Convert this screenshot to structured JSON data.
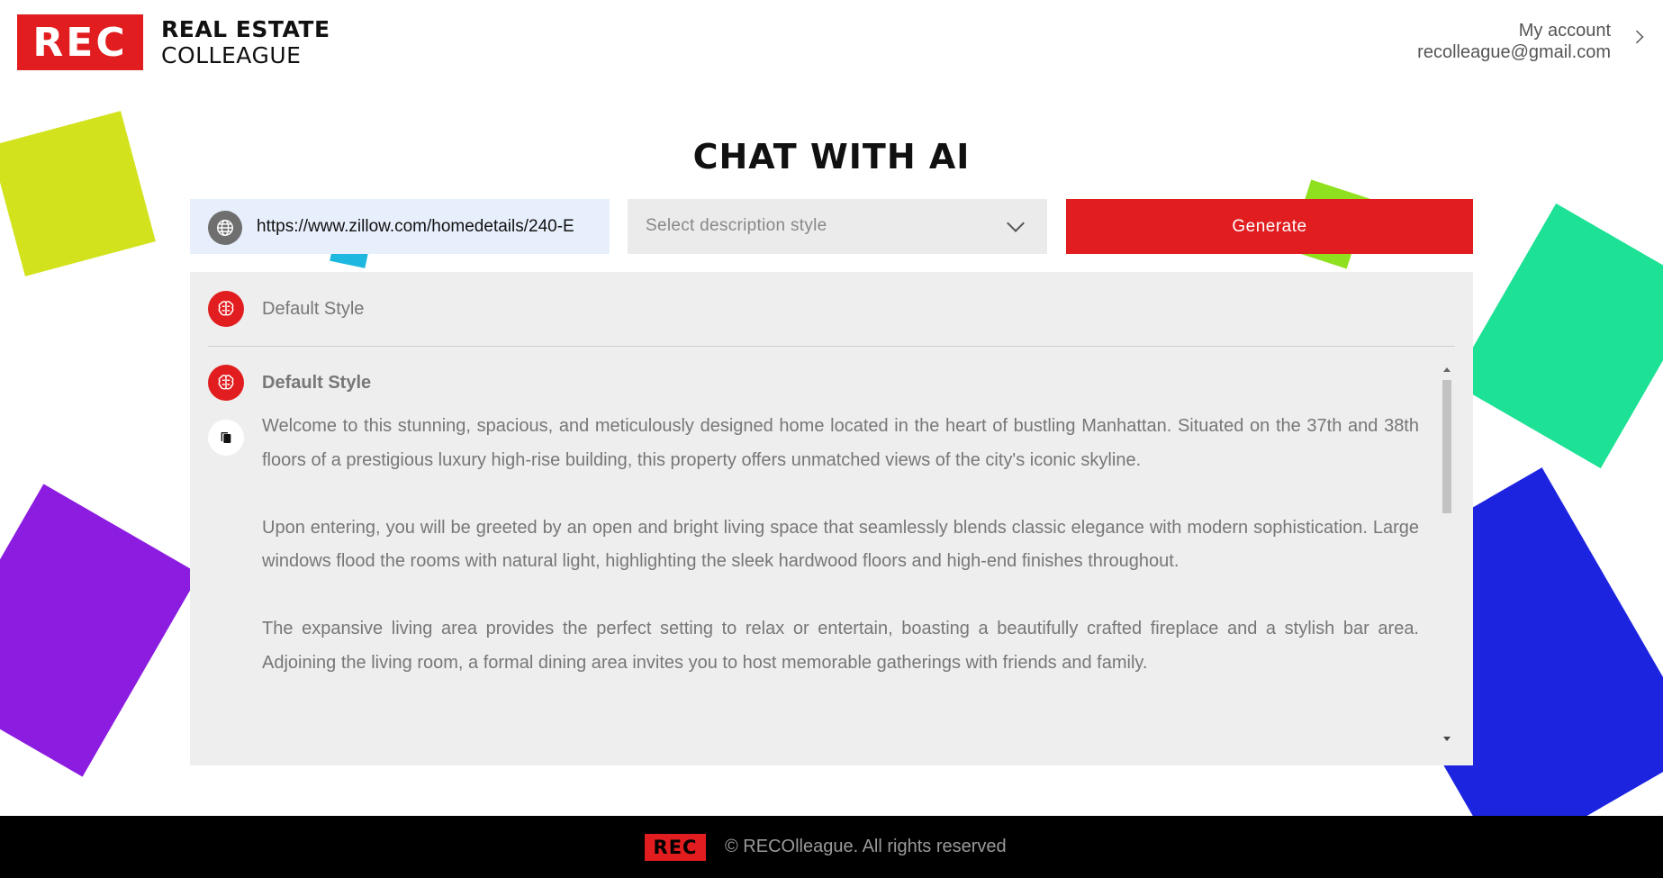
{
  "brand": {
    "logo_text": "REC",
    "name_line1": "REAL ESTATE",
    "name_line2": "COLLEAGUE"
  },
  "account": {
    "label": "My account",
    "email": "recolleague@gmail.com"
  },
  "page": {
    "title": "CHAT WITH AI"
  },
  "form": {
    "url_value": "https://www.zillow.com/homedetails/240-E",
    "style_placeholder": "Select description style",
    "generate_label": "Generate"
  },
  "chat": {
    "request_label": "Default Style",
    "response_title": "Default Style",
    "response_paragraphs": [
      "Welcome to this stunning, spacious, and meticulously designed home located in the heart of bustling Manhattan. Situated on the 37th and 38th floors of a prestigious luxury high-rise building, this property offers unmatched views of the city's iconic skyline.",
      "Upon entering, you will be greeted by an open and bright living space that seamlessly blends classic elegance with modern sophistication. Large windows flood the rooms with natural light, highlighting the sleek hardwood floors and high-end finishes throughout.",
      "The expansive living area provides the perfect setting to relax or entertain, boasting a beautifully crafted fireplace and a stylish bar area. Adjoining the living room, a formal dining area invites you to host memorable gatherings with friends and family."
    ]
  },
  "footer": {
    "logo_text": "REC",
    "copyright": "© RECOlleague. All rights reserved"
  },
  "colors": {
    "brand_red": "#e11d1f",
    "panel_bg": "#eeeeee",
    "url_bg": "#e8effc"
  },
  "icons": [
    "globe-icon",
    "brain-icon",
    "copy-icon",
    "chevron-right-icon",
    "chevron-down-icon"
  ]
}
